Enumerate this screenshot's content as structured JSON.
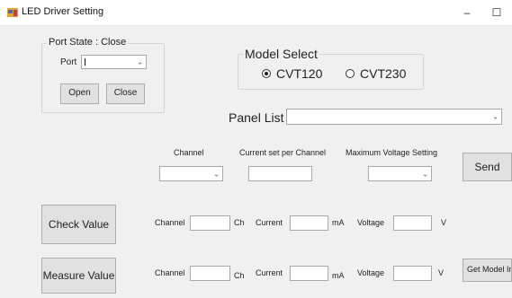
{
  "window": {
    "title": "LED Driver Setting",
    "minimize": "–",
    "maximize": "☐"
  },
  "port": {
    "state_legend": "Port State : Close",
    "port_label": "Port",
    "open_label": "Open",
    "close_label": "Close"
  },
  "model": {
    "legend": "Model Select",
    "options": [
      {
        "label": "CVT120",
        "selected": true
      },
      {
        "label": "CVT230",
        "selected": false
      }
    ]
  },
  "panel": {
    "label": "Panel List"
  },
  "settings": {
    "channel_label": "Channel",
    "current_label": "Current set per Channel",
    "max_voltage_label": "Maximum Voltage Setting",
    "send_label": "Send"
  },
  "check_row": {
    "button_label": "Check Value",
    "channel_label": "Channel",
    "ch_unit": "Ch",
    "current_label": "Current",
    "ma_unit": "mA",
    "voltage_label": "Voltage",
    "v_unit": "V"
  },
  "measure_row": {
    "button_label": "Measure Value",
    "channel_label": "Channel",
    "ch_unit": "Ch",
    "current_label": "Current",
    "ma_unit": "mA",
    "voltage_label": "Voltage",
    "v_unit": "V",
    "get_model_label": "Get Model In"
  }
}
